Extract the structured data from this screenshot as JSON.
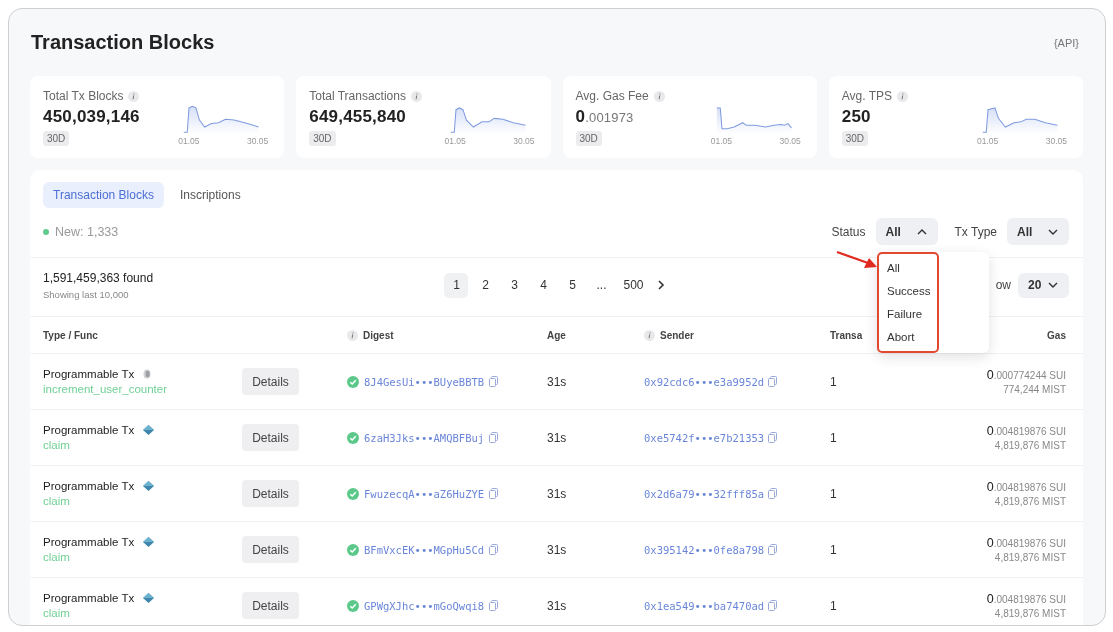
{
  "page": {
    "title": "Transaction Blocks",
    "api_label": "{API}"
  },
  "stats": [
    {
      "label": "Total Tx Blocks",
      "value": "450,039,146",
      "badge": "30D",
      "x_start": "01.05",
      "x_end": "30.05"
    },
    {
      "label": "Total Transactions",
      "value": "649,455,840",
      "badge": "30D",
      "x_start": "01.05",
      "x_end": "30.05"
    },
    {
      "label": "Avg. Gas Fee",
      "value": "**0**.001973",
      "badge": "30D",
      "x_start": "01.05",
      "x_end": "30.05"
    },
    {
      "label": "Avg. TPS",
      "value": "250",
      "badge": "30D",
      "x_start": "01.05",
      "x_end": "30.05"
    }
  ],
  "tabs": [
    {
      "label": "Transaction Blocks",
      "selected": true
    },
    {
      "label": "Inscriptions",
      "selected": false
    }
  ],
  "new_count": "New: 1,333",
  "filters": [
    {
      "label": "Status",
      "value": "All",
      "expanded": true
    },
    {
      "label": "Tx Type",
      "value": "All",
      "expanded": false
    }
  ],
  "results": {
    "found": "1,591,459,363 found",
    "note": "Showing last 10,000"
  },
  "pagination": [
    {
      "label": "1",
      "selected": true
    },
    {
      "label": "2",
      "selected": false
    },
    {
      "label": "3",
      "selected": false
    },
    {
      "label": "4",
      "selected": false
    },
    {
      "label": "5",
      "selected": false
    },
    {
      "label": "...",
      "selected": false
    },
    {
      "label": "500",
      "selected": false
    }
  ],
  "page_size": {
    "label": "ow",
    "value": "20"
  },
  "status_menu": {
    "highlighted": true,
    "options": [
      "All",
      "Success",
      "Failure",
      "Abort"
    ]
  },
  "columns": [
    {
      "label": "Type / Func",
      "info": false
    },
    {
      "label": "Digest",
      "info": true
    },
    {
      "label": "Age",
      "info": false
    },
    {
      "label": "Sender",
      "info": true
    },
    {
      "label": "Transa",
      "info": false
    },
    {
      "label": "Gas",
      "info": false
    }
  ],
  "rows": [
    {
      "type": "Programmable Tx",
      "kind": "coin",
      "func": "increment_user_counter",
      "action": "Details",
      "success": true,
      "digest": "8J4GesUi•••BUyeBBTB",
      "age": "31s",
      "sender": "0x92cdc6•••e3a9952d",
      "transactions": "1",
      "gas": "**0**.000774244 SUI",
      "gas_mist": "774,244 MIST"
    },
    {
      "type": "Programmable Tx",
      "kind": "diamond",
      "func": "claim",
      "action": "Details",
      "digest": "6zaH3Jks•••AMQBFBuj",
      "success": true,
      "age": "31s",
      "sender": "0xe5742f•••e7b21353",
      "transactions": "1",
      "gas": "**0**.004819876 SUI",
      "gas_mist": "4,819,876 MIST"
    },
    {
      "type": "Programmable Tx",
      "kind": "diamond",
      "func": "claim",
      "action": "Details",
      "digest": "FwuzecqA•••aZ6HuZYE",
      "success": true,
      "age": "31s",
      "sender": "0x2d6a79•••32fff85a",
      "transactions": "1",
      "gas": "**0**.004819876 SUI",
      "gas_mist": "4,819,876 MIST"
    },
    {
      "type": "Programmable Tx",
      "kind": "diamond",
      "func": "claim",
      "action": "Details",
      "digest": "BFmVxcEK•••MGpHu5Cd",
      "success": true,
      "age": "31s",
      "sender": "0x395142•••0fe8a798",
      "transactions": "1",
      "gas": "**0**.004819876 SUI",
      "gas_mist": "4,819,876 MIST"
    },
    {
      "type": "Programmable Tx",
      "kind": "diamond",
      "func": "claim",
      "action": "Details",
      "digest": "GPWgXJhc•••mGoQwqi8",
      "success": true,
      "age": "31s",
      "sender": "0x1ea549•••ba7470ad",
      "transactions": "1",
      "gas": "**0**.004819876 SUI",
      "gas_mist": "4,819,876 MIST"
    }
  ]
}
